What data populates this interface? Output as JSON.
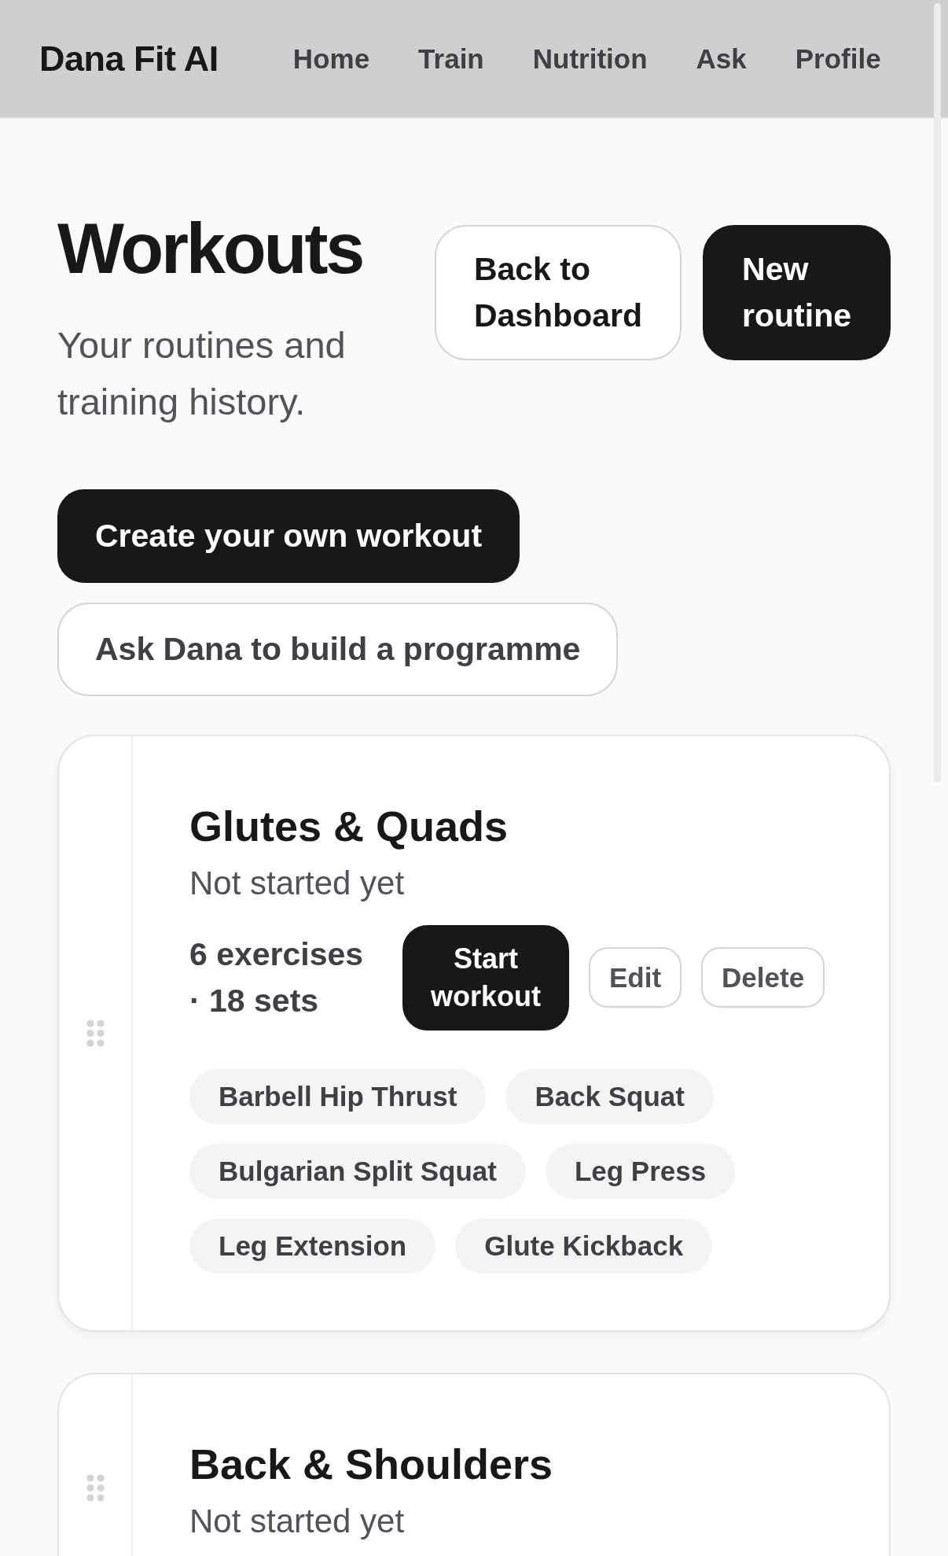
{
  "navbar": {
    "brand": "Dana Fit AI",
    "links": [
      "Home",
      "Train",
      "Nutrition",
      "Ask",
      "Profile"
    ]
  },
  "header": {
    "title": "Workouts",
    "subtitle": "Your routines and training history.",
    "actions": [
      {
        "label": "Back to Dashboard",
        "kind": "outline"
      },
      {
        "label": "New routine",
        "kind": "primary"
      }
    ]
  },
  "quick_actions": [
    {
      "label": "Create your own workout",
      "kind": "primary"
    },
    {
      "label": "Ask Dana to build a programme",
      "kind": "outline"
    }
  ],
  "routines": [
    {
      "name": "Glutes & Quads",
      "status": "Not started yet",
      "summary": "6 exercises · 18 sets",
      "actions": [
        {
          "label": "Start workout",
          "kind": "primary"
        },
        {
          "label": "Edit",
          "kind": "outline"
        },
        {
          "label": "Delete",
          "kind": "outline"
        }
      ],
      "exercises": [
        "Barbell Hip Thrust",
        "Back Squat",
        "Bulgarian Split Squat",
        "Leg Press",
        "Leg Extension",
        "Glute Kickback"
      ]
    },
    {
      "name": "Back & Shoulders",
      "status": "Not started yet"
    }
  ]
}
